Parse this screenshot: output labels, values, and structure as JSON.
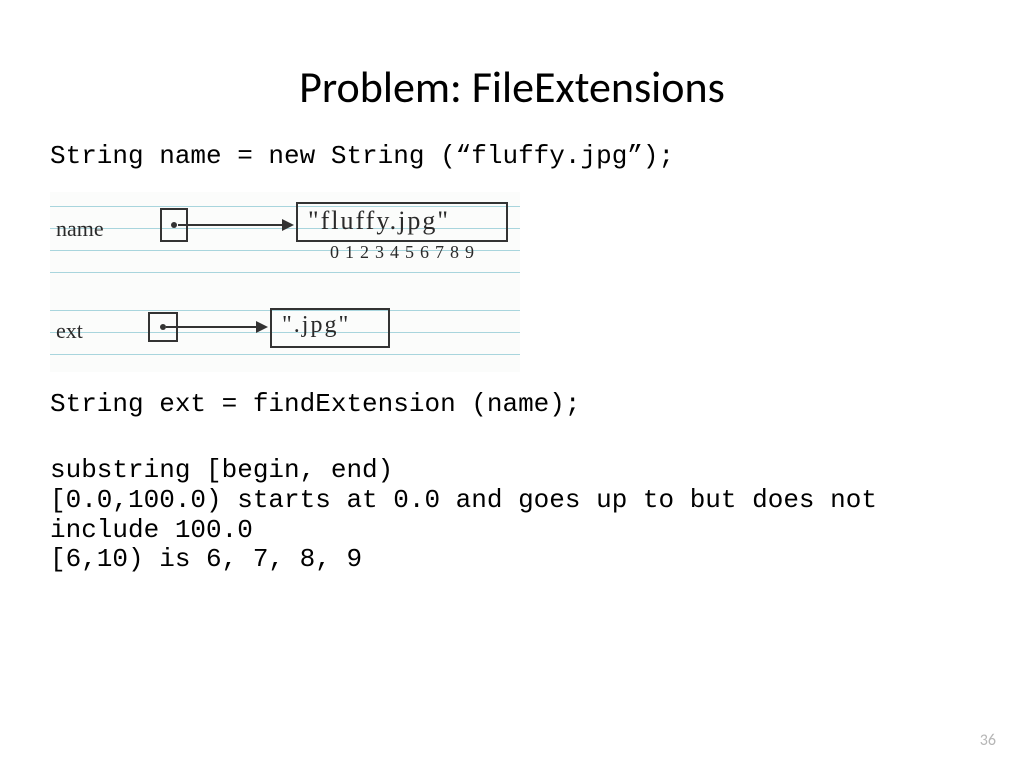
{
  "title": "Problem: FileExtensions",
  "code": {
    "line1": "String name = new String (“fluffy.jpg”);",
    "line2": "String ext = findExtension (name);",
    "line3": "substring [begin, end)",
    "line4": "[0.0,100.0) starts at 0.0 and goes up to but does not include 100.0",
    "line5": "[6,10) is 6, 7, 8, 9"
  },
  "diagram": {
    "label_name": "name",
    "label_ext": "ext",
    "value_name": "\"fluffy.jpg\"",
    "value_ext": "\".jpg\"",
    "indices": "0123456789"
  },
  "page_number": "36"
}
